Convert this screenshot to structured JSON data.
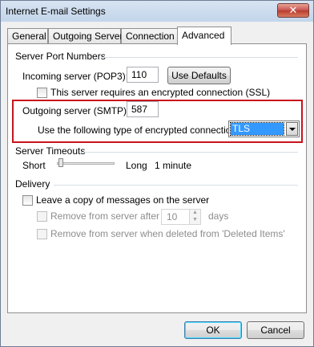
{
  "window": {
    "title": "Internet E-mail Settings",
    "close_glyph": "✕"
  },
  "tabs": [
    {
      "label": "General"
    },
    {
      "label": "Outgoing Server"
    },
    {
      "label": "Connection"
    },
    {
      "label": "Advanced",
      "active": true
    }
  ],
  "server_ports": {
    "group_label": "Server Port Numbers",
    "incoming_label": "Incoming server (POP3):",
    "incoming_value": "110",
    "use_defaults_label": "Use Defaults",
    "ssl_label": "This server requires an encrypted connection (SSL)",
    "ssl_checked": false,
    "outgoing_label": "Outgoing server (SMTP):",
    "outgoing_value": "587",
    "encryption_label": "Use the following type of encrypted connection:",
    "encryption_value": "TLS"
  },
  "timeouts": {
    "group_label": "Server Timeouts",
    "short_label": "Short",
    "long_label": "Long",
    "value_label": "1 minute"
  },
  "delivery": {
    "group_label": "Delivery",
    "leave_copy_label": "Leave a copy of messages on the server",
    "leave_copy_checked": false,
    "remove_after_label": "Remove from server after",
    "remove_after_value": "10",
    "days_label": "days",
    "remove_deleted_label": "Remove from server when deleted from 'Deleted Items'"
  },
  "footer": {
    "ok_label": "OK",
    "cancel_label": "Cancel"
  },
  "colors": {
    "highlight_border": "#c8141c",
    "selection": "#3399ff"
  }
}
